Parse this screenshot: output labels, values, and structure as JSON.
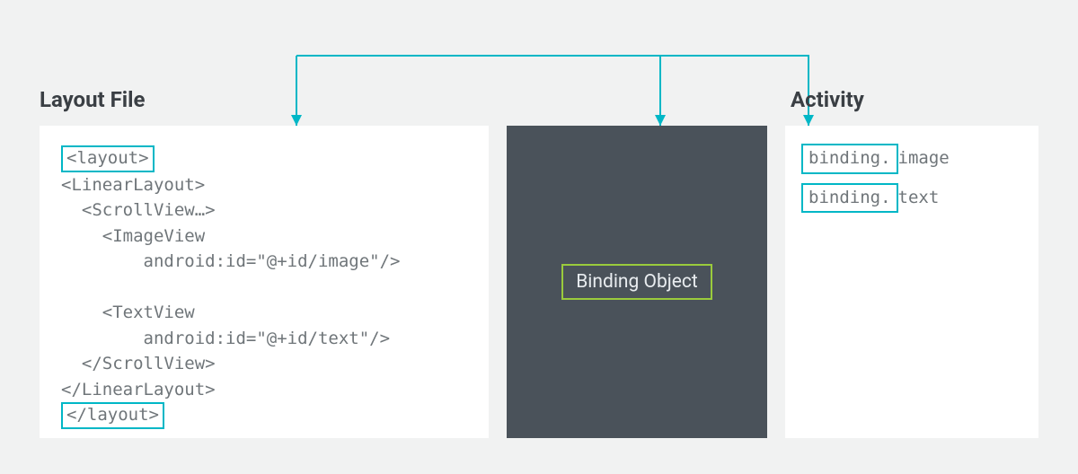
{
  "headings": {
    "layout_file": "Layout File",
    "activity": "Activity"
  },
  "binding_box_label": "Binding Object",
  "layout_code": {
    "open_layout": "<layout>",
    "open_linear": "<LinearLayout>",
    "open_scroll": "  <ScrollView…>",
    "imageview_open": "    <ImageView",
    "imageview_attr": "        android:id=\"@+id/image\"/>",
    "blank": "",
    "textview_open": "    <TextView",
    "textview_attr": "        android:id=\"@+id/text\"/>",
    "close_scroll": "  </ScrollView>",
    "close_linear": "</LinearLayout>",
    "close_layout": "</layout>"
  },
  "activity_code": {
    "row1_prefix": "binding.",
    "row1_suffix": "image",
    "row2_prefix": "binding.",
    "row2_suffix": "text"
  },
  "colors": {
    "accent_teal": "#00b7c6",
    "accent_green": "#9acb3c",
    "panel_dark": "#4a525a",
    "page_bg": "#f1f2f2",
    "text_muted": "#6f7579",
    "heading": "#3a3f44"
  }
}
